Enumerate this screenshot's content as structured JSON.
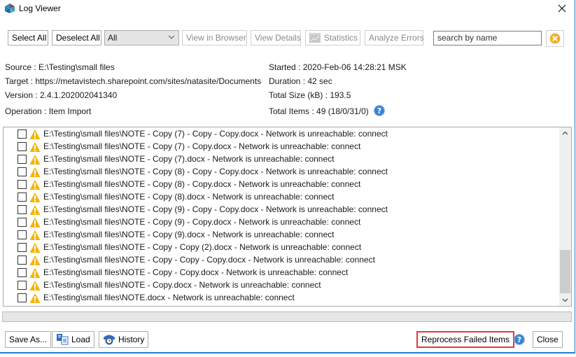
{
  "window": {
    "title": "Log Viewer",
    "close_icon": "close-x-icon",
    "app_icon": "app-logo-icon"
  },
  "toolbar": {
    "select_all": "Select All",
    "deselect_all": "Deselect All",
    "filter_selected": "All",
    "view_in_browser": "View in Browser",
    "view_details": "View Details",
    "statistics": "Statistics",
    "analyze_errors": "Analyze Errors",
    "search_placeholder": "search by name",
    "search_value": ""
  },
  "info": {
    "source": "Source : E:\\Testing\\small files",
    "target": "Target : https://metavistech.sharepoint.com/sites/natasite/Documents",
    "version": "Version : 2.4.1.202002041340",
    "operation": "Operation : Item Import",
    "started": "Started : 2020-Feb-06 14:28:21 MSK",
    "duration": "Duration : 42 sec",
    "total_size": "Total Size (kB) : 193.5",
    "total_items": "Total Items : 49 (18/0/31/0)"
  },
  "log_items": [
    {
      "checked": false,
      "status": "warning",
      "text": "E:\\Testing\\small files\\NOTE - Copy (7) - Copy - Copy.docx - Network is unreachable: connect"
    },
    {
      "checked": false,
      "status": "warning",
      "text": "E:\\Testing\\small files\\NOTE - Copy (7) - Copy.docx - Network is unreachable: connect"
    },
    {
      "checked": false,
      "status": "warning",
      "text": "E:\\Testing\\small files\\NOTE - Copy (7).docx - Network is unreachable: connect"
    },
    {
      "checked": false,
      "status": "warning",
      "text": "E:\\Testing\\small files\\NOTE - Copy (8) - Copy - Copy.docx - Network is unreachable: connect"
    },
    {
      "checked": false,
      "status": "warning",
      "text": "E:\\Testing\\small files\\NOTE - Copy (8) - Copy.docx - Network is unreachable: connect"
    },
    {
      "checked": false,
      "status": "warning",
      "text": "E:\\Testing\\small files\\NOTE - Copy (8).docx - Network is unreachable: connect"
    },
    {
      "checked": false,
      "status": "warning",
      "text": "E:\\Testing\\small files\\NOTE - Copy (9) - Copy - Copy.docx - Network is unreachable: connect"
    },
    {
      "checked": false,
      "status": "warning",
      "text": "E:\\Testing\\small files\\NOTE - Copy (9) - Copy.docx - Network is unreachable: connect"
    },
    {
      "checked": false,
      "status": "warning",
      "text": "E:\\Testing\\small files\\NOTE - Copy (9).docx - Network is unreachable: connect"
    },
    {
      "checked": false,
      "status": "warning",
      "text": "E:\\Testing\\small files\\NOTE - Copy - Copy (2).docx - Network is unreachable: connect"
    },
    {
      "checked": false,
      "status": "warning",
      "text": "E:\\Testing\\small files\\NOTE - Copy - Copy - Copy.docx - Network is unreachable: connect"
    },
    {
      "checked": false,
      "status": "warning",
      "text": "E:\\Testing\\small files\\NOTE - Copy - Copy.docx - Network is unreachable: connect"
    },
    {
      "checked": false,
      "status": "warning",
      "text": "E:\\Testing\\small files\\NOTE - Copy.docx - Network is unreachable: connect"
    },
    {
      "checked": false,
      "status": "warning",
      "text": "E:\\Testing\\small files\\NOTE.docx - Network is unreachable: connect"
    }
  ],
  "progress": 0,
  "footer": {
    "save_as": "Save As...",
    "load": "Load",
    "history": "History",
    "reprocess": "Reprocess Failed Items",
    "close": "Close"
  },
  "colors": {
    "accent_border": "#2b78c8",
    "highlight_red": "#e03c3c",
    "warning_yellow": "#f5b400",
    "help_blue": "#3a84d6",
    "clear_orange": "#f0b030"
  }
}
